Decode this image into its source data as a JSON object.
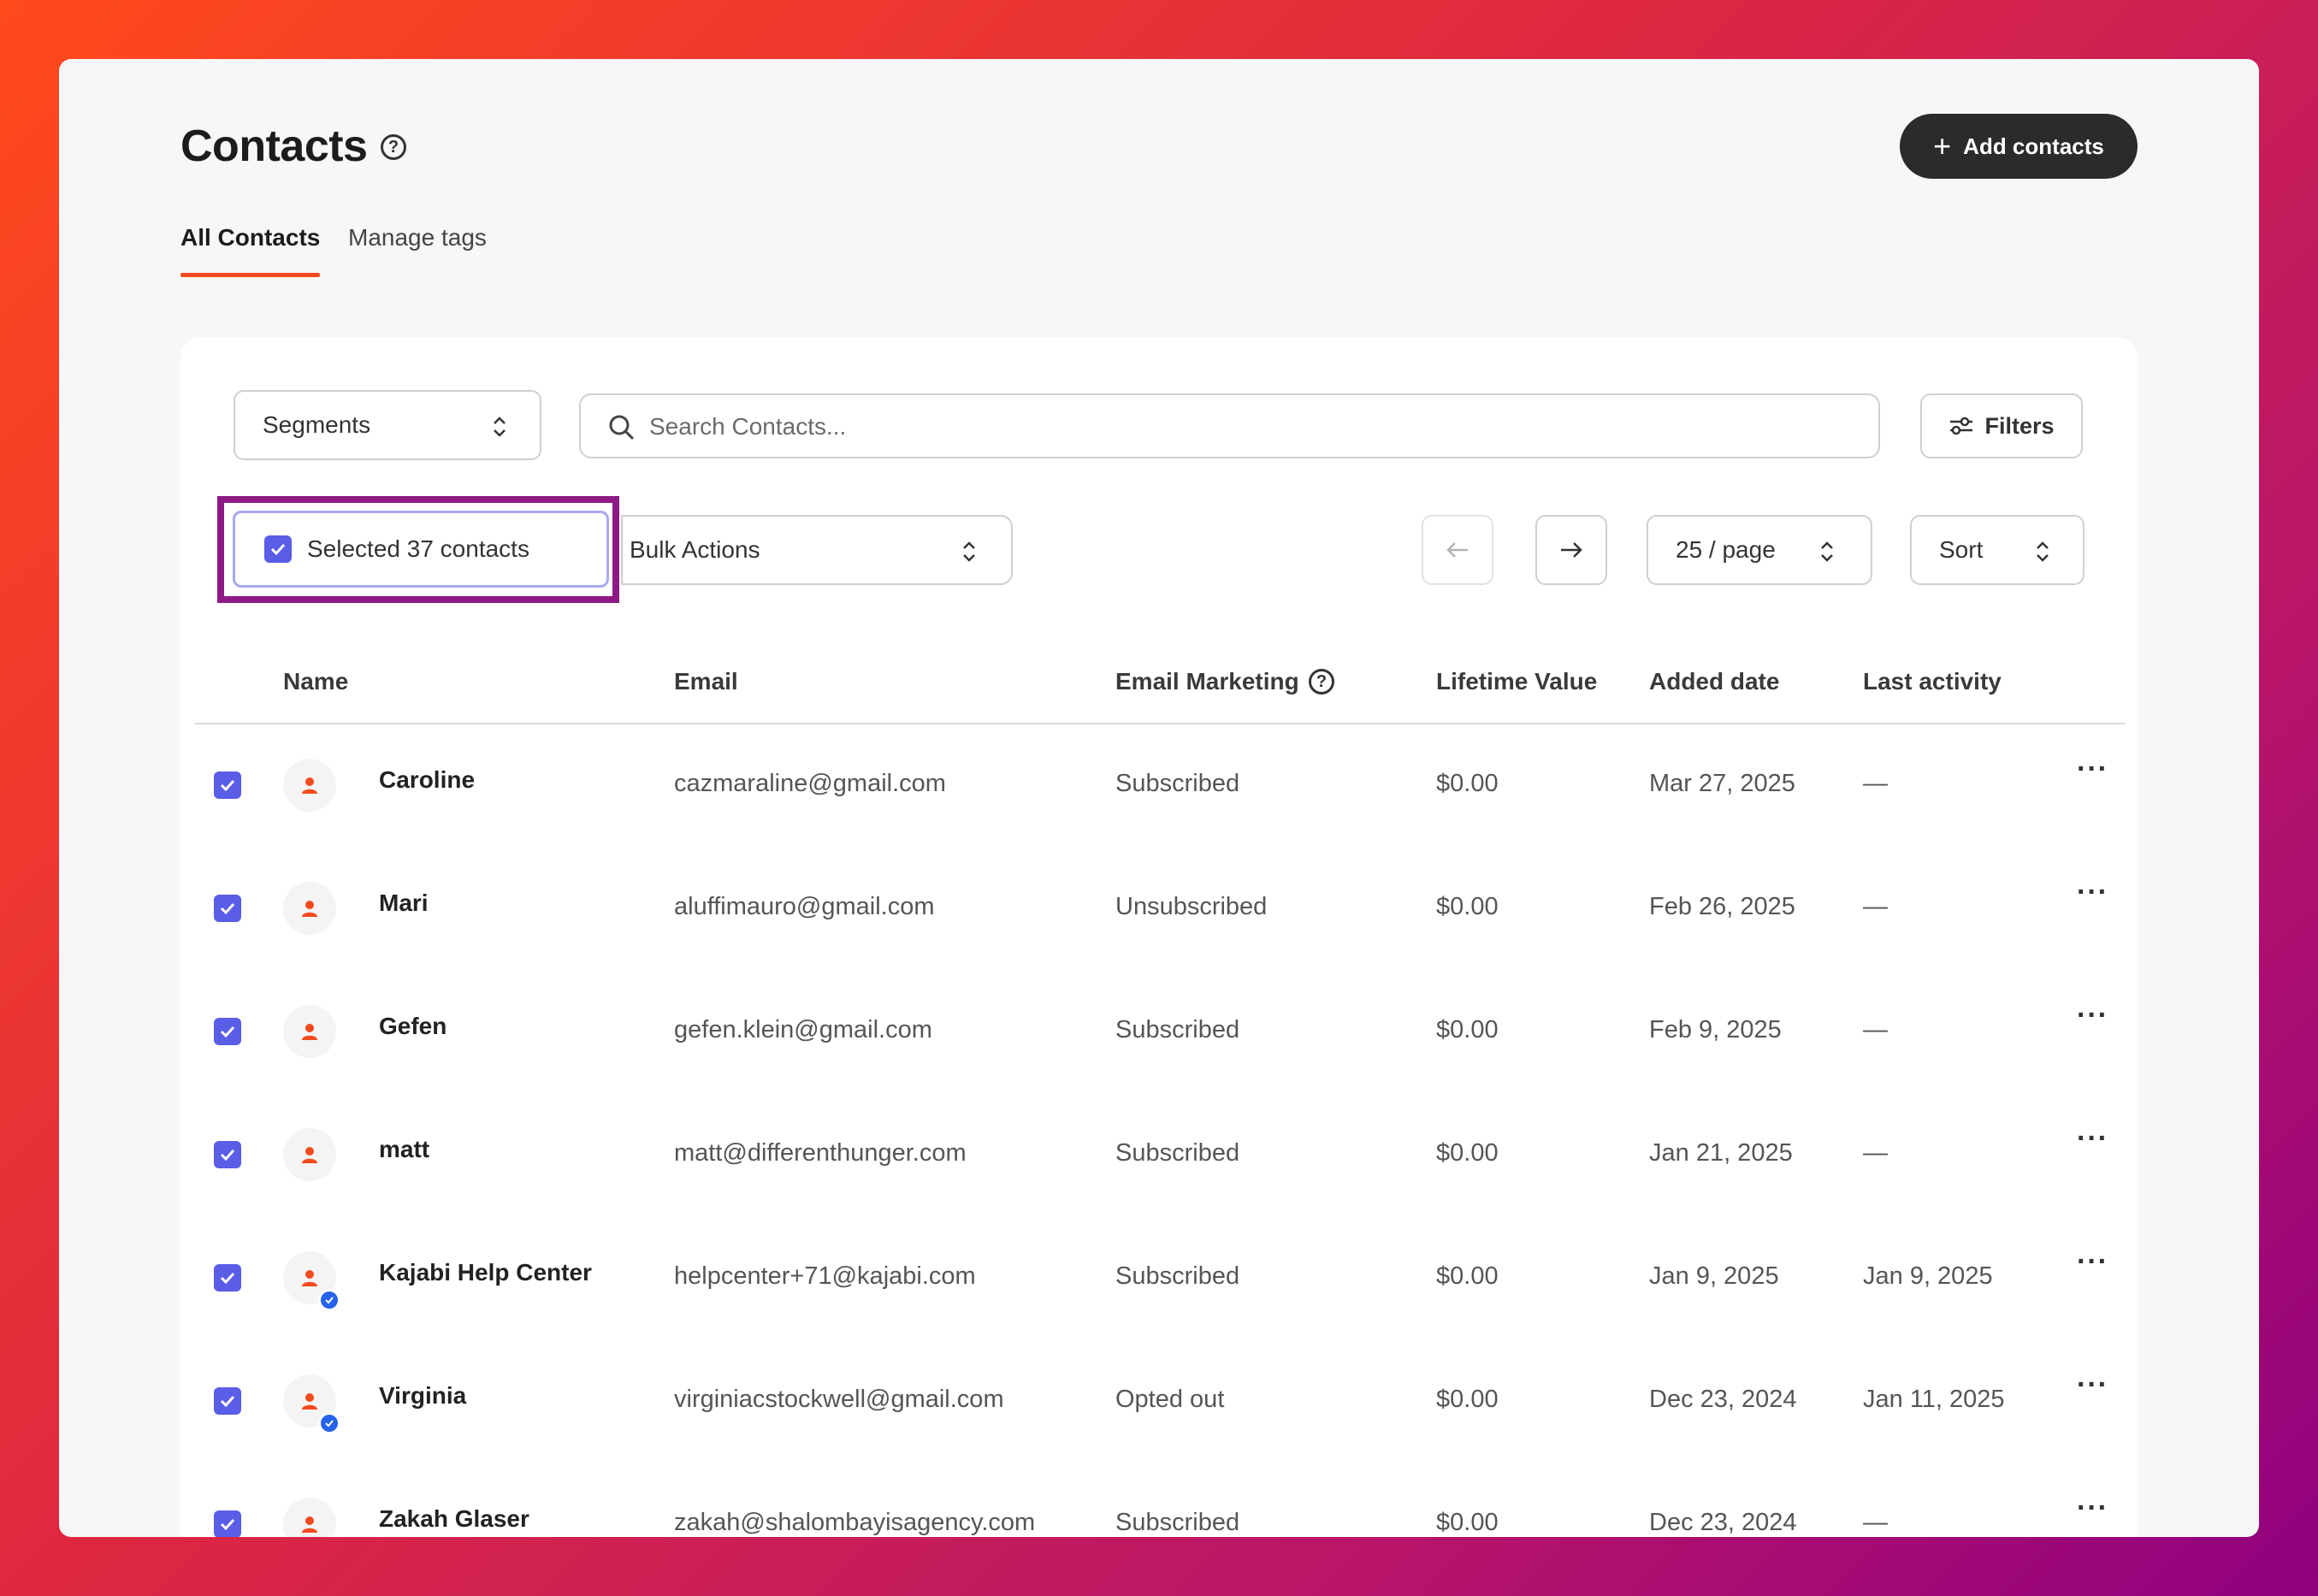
{
  "header": {
    "title": "Contacts",
    "add_button": "Add contacts"
  },
  "tabs": [
    {
      "label": "All Contacts",
      "active": true
    },
    {
      "label": "Manage tags",
      "active": false
    }
  ],
  "toolbar": {
    "segments": "Segments",
    "search_placeholder": "Search Contacts...",
    "filters": "Filters",
    "selected": "Selected 37 contacts",
    "bulk_actions": "Bulk Actions",
    "per_page": "25 / page",
    "sort": "Sort"
  },
  "columns": [
    "Name",
    "Email",
    "Email Marketing",
    "Lifetime Value",
    "Added date",
    "Last activity"
  ],
  "rows": [
    {
      "name": "Caroline",
      "email": "cazmaraline@gmail.com",
      "marketing": "Subscribed",
      "value": "$0.00",
      "added": "Mar 27, 2025",
      "activity": "—",
      "verified": false
    },
    {
      "name": "Mari",
      "email": "aluffimauro@gmail.com",
      "marketing": "Unsubscribed",
      "value": "$0.00",
      "added": "Feb 26, 2025",
      "activity": "—",
      "verified": false
    },
    {
      "name": "Gefen",
      "email": "gefen.klein@gmail.com",
      "marketing": "Subscribed",
      "value": "$0.00",
      "added": "Feb 9, 2025",
      "activity": "—",
      "verified": false
    },
    {
      "name": "matt",
      "email": "matt@differenthunger.com",
      "marketing": "Subscribed",
      "value": "$0.00",
      "added": "Jan 21, 2025",
      "activity": "—",
      "verified": false
    },
    {
      "name": "Kajabi Help Center",
      "email": "helpcenter+71@kajabi.com",
      "marketing": "Subscribed",
      "value": "$0.00",
      "added": "Jan 9, 2025",
      "activity": "Jan 9, 2025",
      "verified": true
    },
    {
      "name": "Virginia",
      "email": "virginiacstockwell@gmail.com",
      "marketing": "Opted out",
      "value": "$0.00",
      "added": "Dec 23, 2024",
      "activity": "Jan 11, 2025",
      "verified": true
    },
    {
      "name": "Zakah Glaser",
      "email": "zakah@shalombayisagency.com",
      "marketing": "Subscribed",
      "value": "$0.00",
      "added": "Dec 23, 2024",
      "activity": "—",
      "verified": true
    }
  ],
  "colors": {
    "accent": "#f24a1d",
    "checkbox": "#5a5de6",
    "highlight": "#8e1a86",
    "verified": "#2563eb"
  }
}
